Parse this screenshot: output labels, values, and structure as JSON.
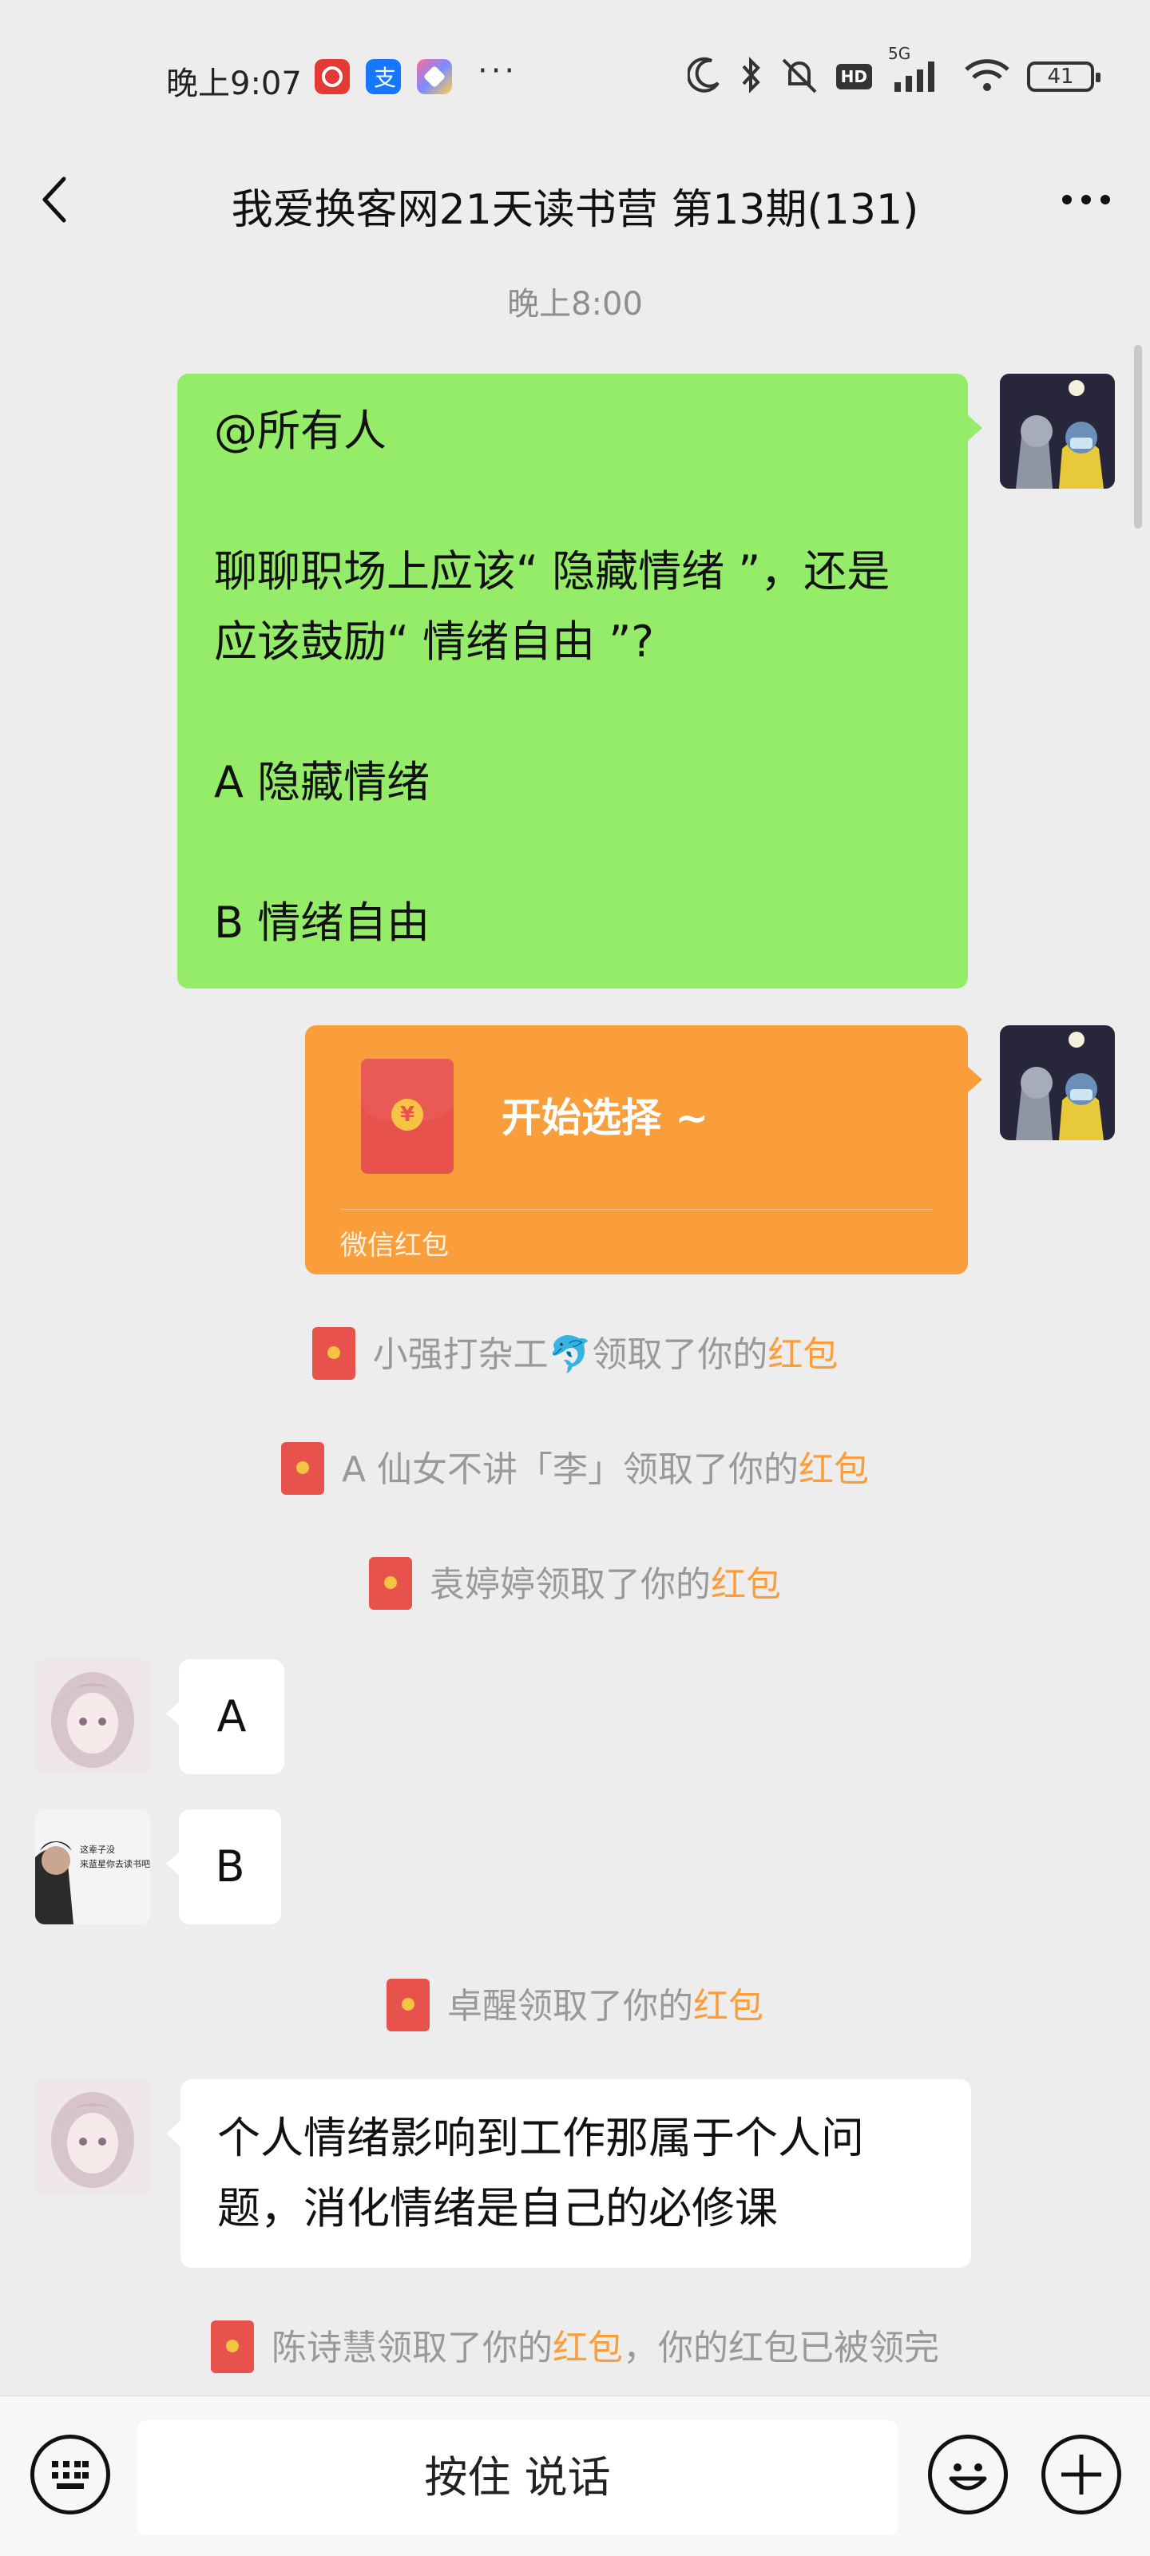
{
  "status_bar": {
    "time": "晚上9:07",
    "dots": "···",
    "network": "5G",
    "hd": "HD",
    "battery": "41"
  },
  "header": {
    "title": "我爱换客网21天读书营 第13期(131)"
  },
  "timestamp": "晚上8:00",
  "messages": {
    "question": {
      "line1": "@所有人",
      "line2": "聊聊职场上应该“ 隐藏情绪 ”，还是",
      "line3": "应该鼓励“ 情绪自由 ”?",
      "line4": "A 隐藏情绪",
      "line5": "B 情绪自由"
    },
    "red_packet": {
      "label": "开始选择 ~",
      "footer": "微信红包",
      "coin": "¥"
    },
    "reply_a": "A",
    "reply_b": "B",
    "reply_long_line1": "个人情绪影响到工作那属于个人问",
    "reply_long_line2": "题，消化情绪是自己的必修课"
  },
  "system": {
    "claim1_name": "小强打杂工🐬领取了你的",
    "claim2_name": "A 仙女不讲「李」领取了你的",
    "claim3_name": "袁婷婷领取了你的",
    "claim4_name": "卓醒领取了你的",
    "claim5_name": "陈诗慧领取了你的",
    "hongbao": "红包",
    "claim5_tail": "，你的红包已被领完"
  },
  "avatar_text": {
    "user_b_line1": "这辈子没",
    "user_b_line2": "来蓝星你去读书吧"
  },
  "input": {
    "talk_label": "按住 说话"
  },
  "colors": {
    "bubble_green": "#95ec69",
    "red_packet": "#fa9d3b",
    "highlight": "#fa9d3b",
    "background": "#ededed"
  }
}
